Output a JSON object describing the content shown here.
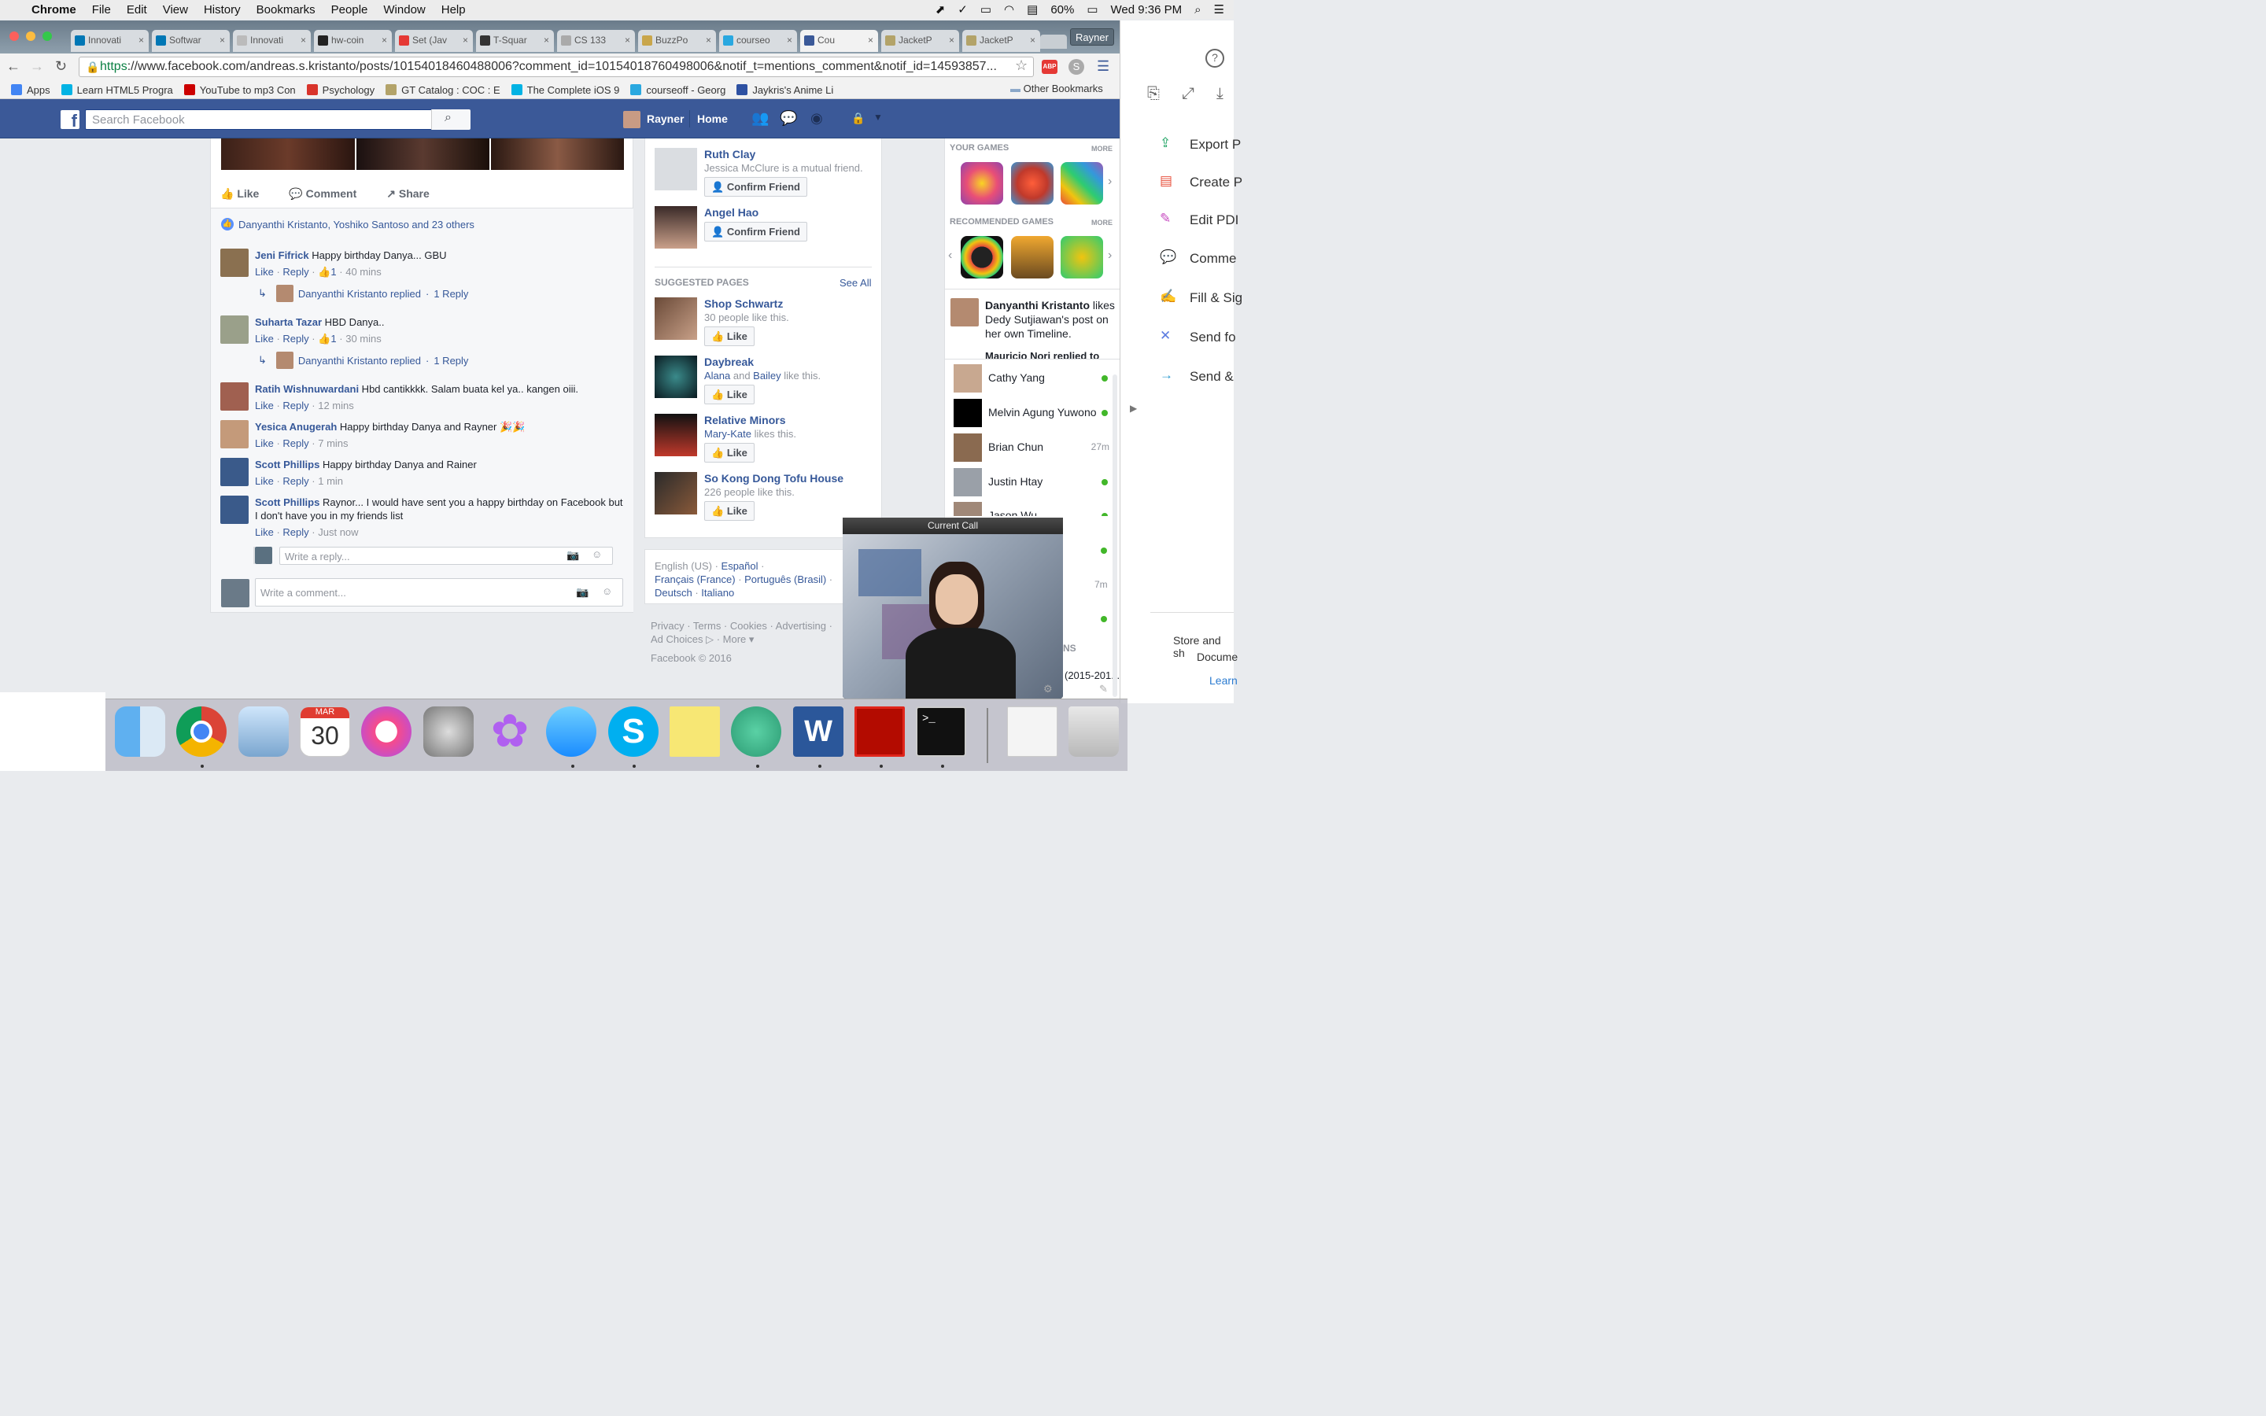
{
  "menubar": {
    "app": "Chrome",
    "items": [
      "File",
      "Edit",
      "View",
      "History",
      "Bookmarks",
      "People",
      "Window",
      "Help"
    ],
    "battery": "60%",
    "clock": "Wed 9:36 PM"
  },
  "chrome": {
    "profile": "Rayner",
    "tabs": [
      {
        "label": "Innovati",
        "color": "#0077b5"
      },
      {
        "label": "Softwar",
        "color": "#0077b5"
      },
      {
        "label": "Innovati",
        "color": "#bbbbbb"
      },
      {
        "label": "hw-coin",
        "color": "#222222"
      },
      {
        "label": "Set (Jav",
        "color": "#e53935"
      },
      {
        "label": "T-Squar",
        "color": "#333333"
      },
      {
        "label": "CS 133",
        "color": "#aaaaaa"
      },
      {
        "label": "BuzzPo",
        "color": "#c9a64b"
      },
      {
        "label": "courseo",
        "color": "#29a8e0"
      },
      {
        "label": "Cou",
        "color": "#3b5998"
      },
      {
        "label": "JacketP",
        "color": "#b3a369"
      },
      {
        "label": "JacketP",
        "color": "#b3a369"
      }
    ],
    "url_scheme": "https",
    "url_rest": "://www.facebook.com/andreas.s.kristanto/posts/10154018460488006?comment_id=10154018760498006&notif_t=mentions_comment&notif_id=14593857...",
    "abp_badge": "ABP",
    "bookmarks": [
      {
        "label": "Apps",
        "color": "#4285f4"
      },
      {
        "label": "Learn HTML5 Progra",
        "color": "#02b3e4"
      },
      {
        "label": "YouTube to mp3 Con",
        "color": "#cc0000"
      },
      {
        "label": "Psychology",
        "color": "#d9342b"
      },
      {
        "label": "GT Catalog : COC : E",
        "color": "#b3a369"
      },
      {
        "label": "The Complete iOS 9",
        "color": "#02b3e4"
      },
      {
        "label": "courseoff - Georg",
        "color": "#29a8e0"
      },
      {
        "label": "Jaykris's Anime Li",
        "color": "#2e51a2"
      }
    ],
    "other_bookmarks": "Other Bookmarks"
  },
  "fb": {
    "logo": "f",
    "search_placeholder": "Search Facebook",
    "user": "Rayner",
    "home": "Home",
    "actions": {
      "like": "Like",
      "comment": "Comment",
      "share": "Share"
    },
    "likes_summary": "Danyanthi Kristanto, Yoshiko Santoso and 23 others",
    "comments": [
      {
        "name": "Jeni Fifrick",
        "text": " Happy birthday Danya... GBU",
        "like": "Like",
        "reply": "Reply",
        "count": "1",
        "time": "40 mins",
        "replied_by": "Danyanthi Kristanto replied",
        "replies": "1 Reply"
      },
      {
        "name": "Suharta Tazar",
        "text": " HBD Danya..",
        "like": "Like",
        "reply": "Reply",
        "count": "1",
        "time": "30 mins",
        "replied_by": "Danyanthi Kristanto replied",
        "replies": "1 Reply"
      },
      {
        "name": "Ratih Wishnuwardani",
        "text": " Hbd cantikkkk. Salam buata kel ya.. kangen oiii.",
        "like": "Like",
        "reply": "Reply",
        "time": "12 mins"
      },
      {
        "name": "Yesica Anugerah",
        "text": " Happy birthday Danya and Rayner 🎉🎉",
        "like": "Like",
        "reply": "Reply",
        "time": "7 mins"
      },
      {
        "name": "Scott Phillips",
        "text": " Happy birthday Danya and Rainer",
        "like": "Like",
        "reply": "Reply",
        "time": "1 min"
      },
      {
        "name": "Scott Phillips",
        "text": " Raynor... I would have sent you a happy birthday on Facebook but I don't have you in my friends list",
        "like": "Like",
        "reply": "Reply",
        "time": "Just now"
      }
    ],
    "reply_placeholder": "Write a reply...",
    "comment_placeholder": "Write a comment...",
    "friend_requests": [
      {
        "name": "Ruth Clay",
        "sub": "Jessica McClure is a mutual friend.",
        "button": "Confirm Friend"
      },
      {
        "name": "Angel Hao",
        "sub": "",
        "button": "Confirm Friend"
      }
    ],
    "suggested_title": "SUGGESTED PAGES",
    "see_all": "See All",
    "pages": [
      {
        "name": "Shop Schwartz",
        "sub": "30 people like this.",
        "button": "Like"
      },
      {
        "name": "Daybreak",
        "sub_a": "Alana",
        "sub_and": " and ",
        "sub_b": "Bailey",
        "sub_tail": " like this.",
        "button": "Like"
      },
      {
        "name": "Relative Minors",
        "sub_a": "Mary-Kate",
        "sub_tail": " likes this.",
        "button": "Like"
      },
      {
        "name": "So Kong Dong Tofu House",
        "sub": "226 people like this.",
        "button": "Like"
      }
    ],
    "languages": {
      "l1": "English (US) · ",
      "l2": "Español",
      "l3": " · ",
      "l4": "Français (France)",
      "l5": " · ",
      "l6": "Português (Brasil)",
      "l7": " · ",
      "l8": "Deutsch",
      "l9": " · ",
      "l10": "Italiano"
    },
    "footer_links": "Privacy · Terms · Cookies · Advertising · ",
    "footer_links2": "Ad Choices ▷ · More ▾",
    "copyright": "Facebook © 2016",
    "your_games": "YOUR GAMES",
    "recommended_games": "RECOMMENDED GAMES",
    "more": "MORE",
    "ticker": {
      "name": "Danyanthi Kristanto",
      "text": " likes Dedy Sutjiawan's post on her own Timeline."
    },
    "ticker_cut": "Mauricio Nori replied to his",
    "chats": [
      {
        "name": "Cathy Yang",
        "status": "online"
      },
      {
        "name": "Melvin Agung Yuwono",
        "status": "online"
      },
      {
        "name": "Brian Chun",
        "status": "27m"
      },
      {
        "name": "Justin Htay",
        "status": "online"
      },
      {
        "name": "Jason Wu",
        "status": "online"
      }
    ],
    "chat_extra": {
      "time": "7m",
      "label1": "NS",
      "label2": "(2015-201..."
    }
  },
  "call": {
    "title": "Current Call"
  },
  "acrobat": {
    "tools": [
      "Export P",
      "Create P",
      "Edit PDI",
      "Comme",
      "Fill & Sig",
      "Send fo",
      "Send &"
    ],
    "store1": "Store and sh",
    "store2": "Docume",
    "learn": "Learn"
  },
  "dock": {
    "calendar_month": "MAR",
    "calendar_day": "30"
  }
}
